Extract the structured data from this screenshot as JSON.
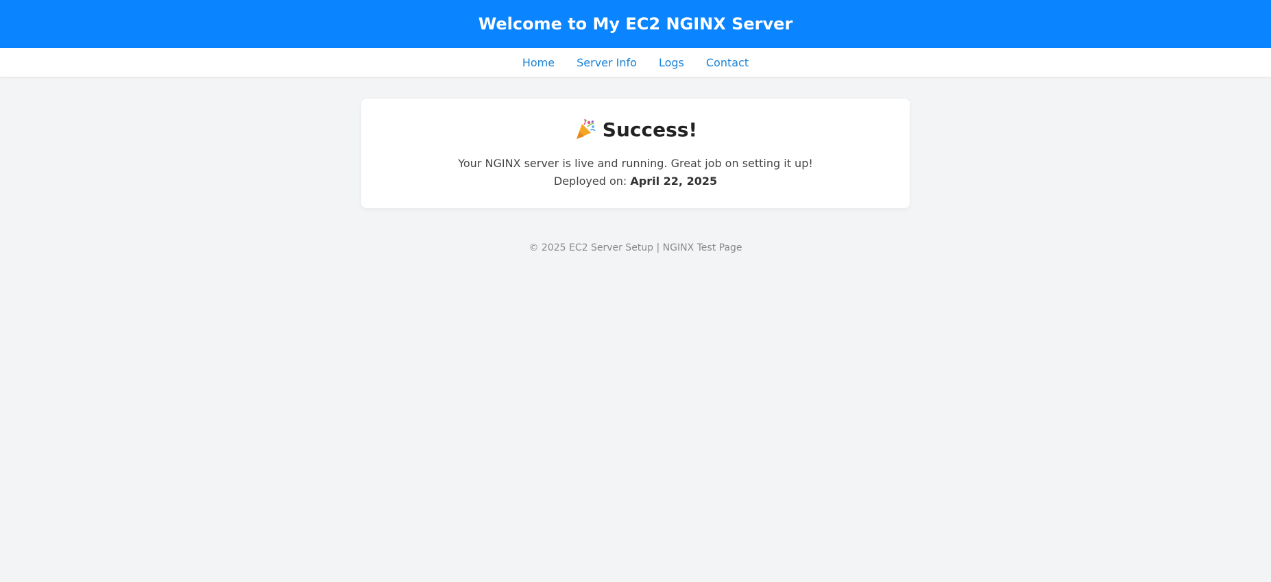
{
  "header": {
    "title": "Welcome to My EC2 NGINX Server",
    "background": "#0a84ff"
  },
  "nav": {
    "items": [
      {
        "label": "Home"
      },
      {
        "label": "Server Info"
      },
      {
        "label": "Logs"
      },
      {
        "label": "Contact"
      }
    ],
    "link_color": "#1a82d6"
  },
  "card": {
    "icon": "party-popper-icon",
    "title": "Success!",
    "message": "Your NGINX server is live and running. Great job on setting it up!",
    "deployed_label": "Deployed on:",
    "deployed_date": "April 22, 2025"
  },
  "footer": {
    "text": "© 2025 EC2 Server Setup | NGINX Test Page"
  }
}
